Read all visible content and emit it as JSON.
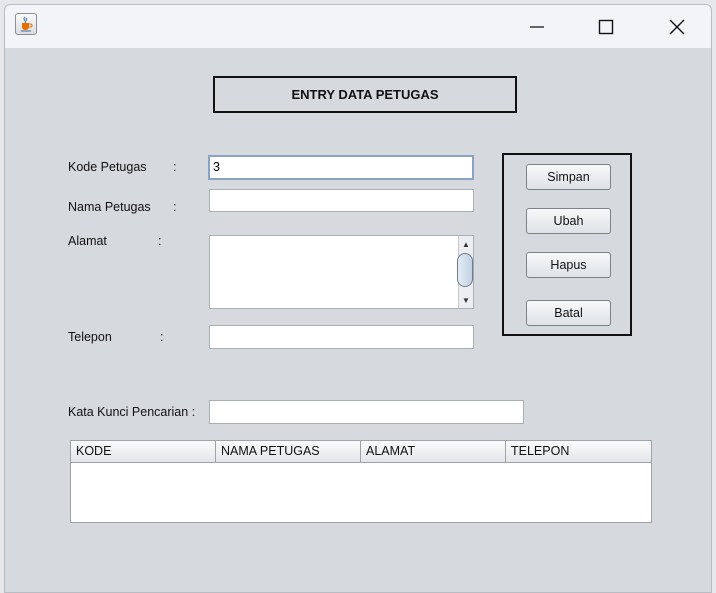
{
  "window": {
    "icon": "java-cup-icon",
    "controls": [
      "minimize-icon",
      "maximize-icon",
      "close-icon"
    ]
  },
  "form": {
    "title": "ENTRY DATA PETUGAS",
    "kode": {
      "label": "Kode Petugas",
      "colon": ":",
      "value": "3"
    },
    "nama": {
      "label": "Nama Petugas",
      "colon": ":",
      "value": ""
    },
    "alamat": {
      "label": "Alamat",
      "colon": ":",
      "value": ""
    },
    "telepon": {
      "label": "Telepon",
      "colon": ":",
      "value": ""
    },
    "search": {
      "label": "Kata Kunci Pencarian :",
      "value": ""
    }
  },
  "buttons": {
    "simpan": "Simpan",
    "ubah": "Ubah",
    "hapus": "Hapus",
    "batal": "Batal"
  },
  "table": {
    "columns": [
      "KODE",
      "NAMA PETUGAS",
      "ALAMAT",
      "TELEPON"
    ],
    "rows": []
  },
  "colors": {
    "window_bg": "#d6d9de",
    "titlebar_bg": "#f3f4f7",
    "focus_border": "#8aa2c4"
  }
}
